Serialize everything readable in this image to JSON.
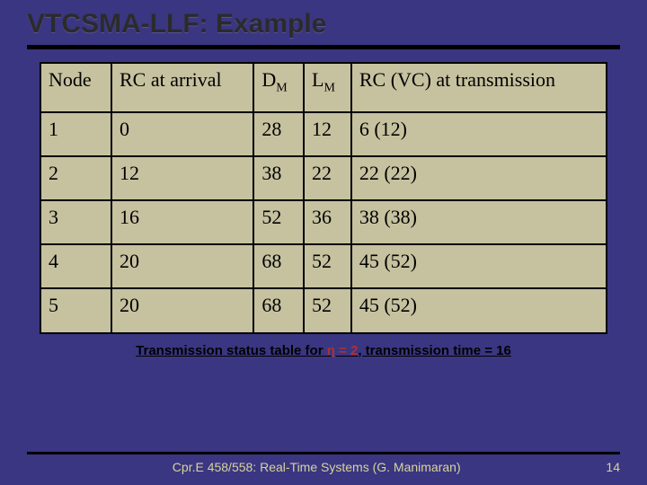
{
  "title": "VTCSMA-LLF: Example",
  "table": {
    "headers": {
      "node": "Node",
      "rc_arrival": "RC at arrival",
      "dm_base": "D",
      "dm_sub": "M",
      "lm_base": "L",
      "lm_sub": "M",
      "rc_vc": "RC (VC) at transmission"
    },
    "rows": [
      {
        "node": "1",
        "rc": "0",
        "dm": "28",
        "lm": "12",
        "rcvc": "6 (12)"
      },
      {
        "node": "2",
        "rc": "12",
        "dm": "38",
        "lm": "22",
        "rcvc": "22 (22)"
      },
      {
        "node": "3",
        "rc": "16",
        "dm": "52",
        "lm": "36",
        "rcvc": "38 (38)"
      },
      {
        "node": "4",
        "rc": "20",
        "dm": "68",
        "lm": "52",
        "rcvc": "45 (52)"
      },
      {
        "node": "5",
        "rc": "20",
        "dm": "68",
        "lm": "52",
        "rcvc": "45 (52)"
      }
    ]
  },
  "caption": {
    "pre": "Transmission status table for ",
    "eta": "η = 2",
    "post": ", transmission time = 16"
  },
  "footer": {
    "course": "Cpr.E 458/558: Real-Time Systems (G. Manimaran)",
    "page": "14"
  },
  "chart_data": {
    "type": "table",
    "title": "VTCSMA-LLF: Example",
    "columns": [
      "Node",
      "RC at arrival",
      "D_M",
      "L_M",
      "RC (VC) at transmission"
    ],
    "rows": [
      [
        "1",
        0,
        28,
        12,
        "6 (12)"
      ],
      [
        "2",
        12,
        38,
        22,
        "22 (22)"
      ],
      [
        "3",
        16,
        52,
        36,
        "38 (38)"
      ],
      [
        "4",
        20,
        68,
        52,
        "45 (52)"
      ],
      [
        "5",
        20,
        68,
        52,
        "45 (52)"
      ]
    ],
    "annotations": [
      "Transmission status table for η = 2, transmission time = 16"
    ]
  }
}
